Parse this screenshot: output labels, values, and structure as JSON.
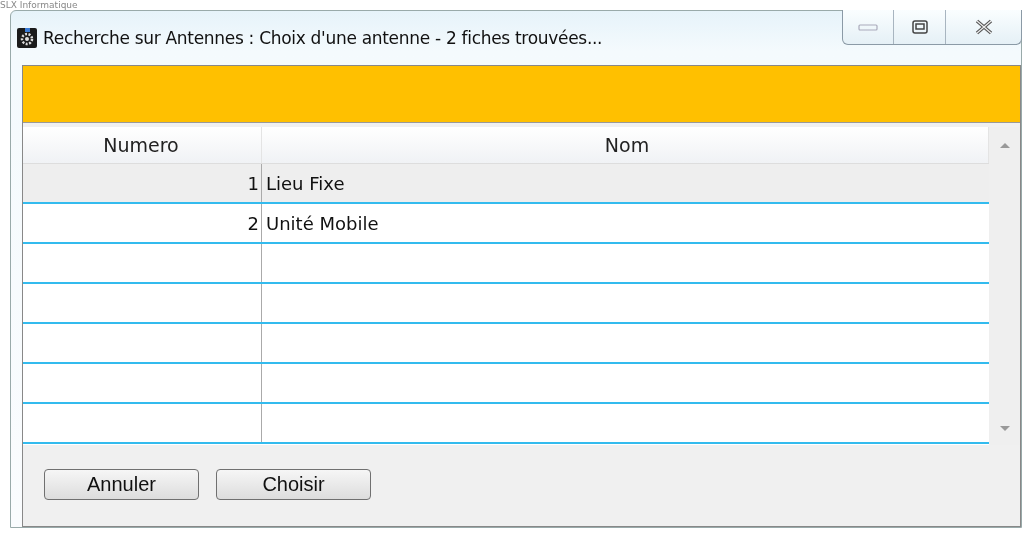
{
  "page_header": "SLX Informatique",
  "window": {
    "title": "Recherche sur Antennes : Choix d'une antenne - 2 fiches trouvées..."
  },
  "table": {
    "columns": [
      "Numero",
      "Nom"
    ],
    "rows": [
      {
        "numero": "1",
        "nom": "Lieu Fixe",
        "selected": true
      },
      {
        "numero": "2",
        "nom": "Unité Mobile",
        "selected": false
      }
    ]
  },
  "buttons": [
    "Annuler",
    "Choisir"
  ]
}
